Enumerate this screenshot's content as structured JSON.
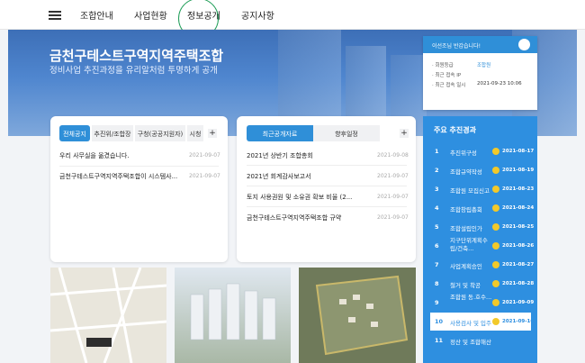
{
  "nav": {
    "items": [
      "조합안내",
      "사업현황",
      "정보공개",
      "공지사항"
    ]
  },
  "hero": {
    "title": "금천구테스트구역지역주택조합",
    "subtitle": "정비사업 추진과정을 유리알처럼 투명하게 공개"
  },
  "login": {
    "greeting": "이선조님 반갑습니다!",
    "rows": [
      {
        "label": "회원등급",
        "value": "조합원"
      },
      {
        "label": "최근 접속 IP",
        "value": ""
      },
      {
        "label": "최근 접속 일시",
        "value": "2021-09-23 10:06"
      }
    ]
  },
  "notice": {
    "tabs": [
      "전체공지",
      "추진위/조합장",
      "구청(공공지원자)",
      "시청"
    ],
    "plus": "+",
    "rows": [
      {
        "title": "우리 사무실을 옮겼습니다.",
        "date": "2021-09-07"
      },
      {
        "title": "금천구테스트구역지역주택조합이 시스템사...",
        "date": "2021-09-07"
      }
    ]
  },
  "info": {
    "tabs": [
      "최근공개자료",
      "향후일정"
    ],
    "plus": "+",
    "rows": [
      {
        "title": "2021년 상반기 조합총회",
        "date": "2021-09-08"
      },
      {
        "title": "2021년 회계감사보고서",
        "date": "2021-09-07"
      },
      {
        "title": "토지 사용권원 및 소유권 확보 비율 (2...",
        "date": "2021-09-07"
      },
      {
        "title": "금천구테스트구역지역주택조합 규약",
        "date": "2021-09-07"
      }
    ]
  },
  "timeline": {
    "title": "주요 추진경과",
    "items": [
      {
        "num": "1",
        "label": "추진위구성",
        "date": "2021-08-17",
        "done": true
      },
      {
        "num": "2",
        "label": "조합규약작성",
        "date": "2021-08-19",
        "done": true
      },
      {
        "num": "3",
        "label": "조합원 모집신고",
        "date": "2021-08-23",
        "done": true
      },
      {
        "num": "4",
        "label": "조합창립총회",
        "date": "2021-08-24",
        "done": true
      },
      {
        "num": "5",
        "label": "조합설립인가",
        "date": "2021-08-25",
        "done": true
      },
      {
        "num": "6",
        "label": "지구단위계획수립/건축...",
        "date": "2021-08-26",
        "done": true
      },
      {
        "num": "7",
        "label": "사업계획승인",
        "date": "2021-08-27",
        "done": true
      },
      {
        "num": "8",
        "label": "철거 및 착공",
        "date": "2021-08-28",
        "done": true
      },
      {
        "num": "9",
        "label": "조합원 동.호수...",
        "date": "2021-09-09",
        "done": true
      },
      {
        "num": "10",
        "label": "사용검사 및 입주",
        "date": "2021-09-10",
        "done": true
      },
      {
        "num": "11",
        "label": "정산 및 조합해산",
        "date": "",
        "done": false
      }
    ]
  },
  "colors": {
    "accent": "#2f8fd8",
    "check": "#f2c92a",
    "nav_circle": "#1e9d57"
  }
}
